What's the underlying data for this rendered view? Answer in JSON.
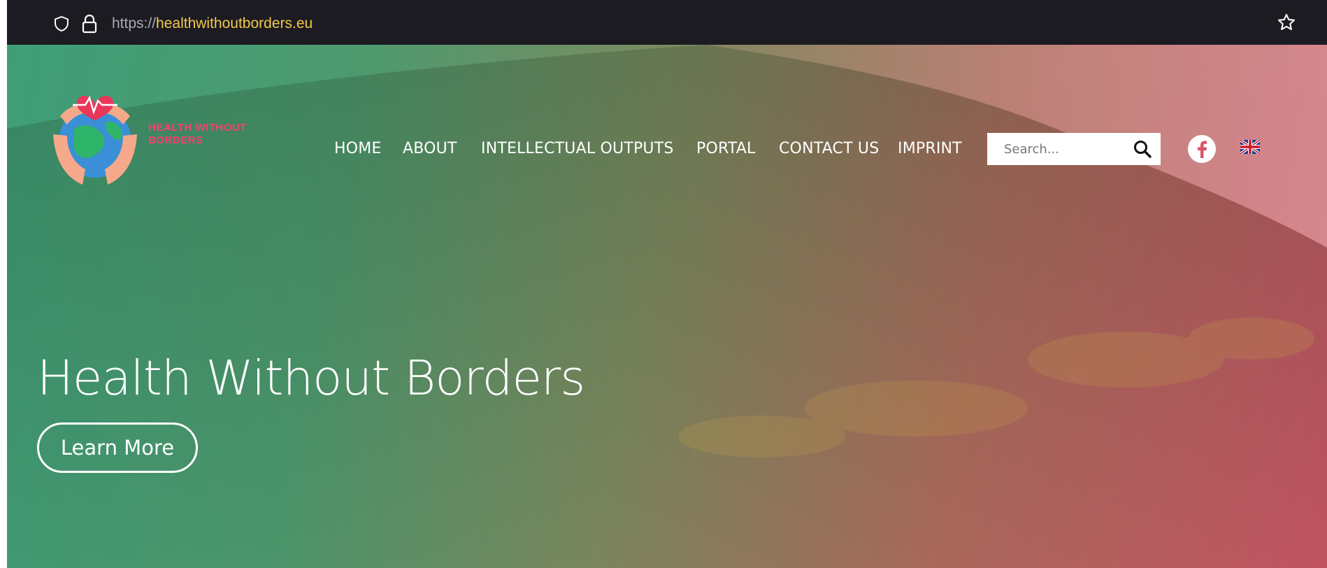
{
  "browser": {
    "url_scheme": "https://",
    "url_host": "healthwithoutborders.eu"
  },
  "site": {
    "logo_text": "HEALTH WITHOUT BORDERS"
  },
  "nav": {
    "items": [
      "HOME",
      "ABOUT",
      "INTELLECTUAL OUTPUTS",
      "PORTAL",
      "CONTACT US",
      "IMPRINT"
    ]
  },
  "search": {
    "placeholder": "Search..."
  },
  "hero": {
    "title": "Health Without Borders",
    "button_label": "Learn More"
  },
  "icons": {
    "shield": "shield-icon",
    "lock": "lock-icon",
    "star": "star-icon",
    "search": "search-icon",
    "facebook": "facebook-icon",
    "flag": "uk-flag-icon"
  },
  "colors": {
    "browser_bar": "#1c1b22",
    "url_host": "#f2c94c",
    "logo_text": "#ff3d6e",
    "hero_left": "#3f9e78",
    "hero_right": "#c95464",
    "nav_text": "#ffffff"
  }
}
